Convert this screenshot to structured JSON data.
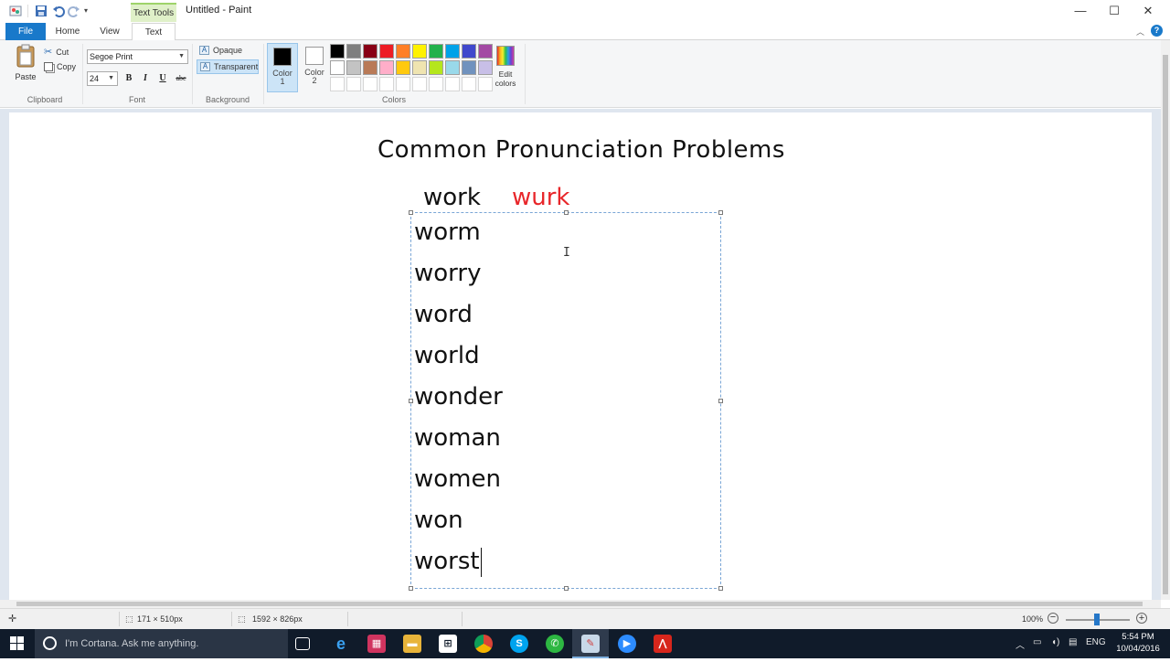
{
  "window": {
    "title": "Untitled - Paint",
    "context_tab": "Text Tools",
    "minimize": "—",
    "maximize": "☐",
    "close": "✕"
  },
  "ribbon_tabs": {
    "file": "File",
    "home": "Home",
    "view": "View",
    "text": "Text"
  },
  "clipboard": {
    "paste": "Paste",
    "cut": "Cut",
    "copy": "Copy",
    "group": "Clipboard"
  },
  "font": {
    "family": "Segoe Print",
    "size": "24",
    "bold": "B",
    "italic": "I",
    "underline": "U",
    "strike": "abc",
    "group": "Font"
  },
  "background": {
    "opaque": "Opaque",
    "transparent": "Transparent",
    "group": "Background"
  },
  "colors": {
    "color1_label": "Color",
    "color1_num": "1",
    "color2_label": "Color",
    "color2_num": "2",
    "color1_value": "#000000",
    "color2_value": "#ffffff",
    "edit_label_1": "Edit",
    "edit_label_2": "colors",
    "group": "Colors",
    "palette": [
      "#000000",
      "#7f7f7f",
      "#880015",
      "#ed1c24",
      "#ff7f27",
      "#fff200",
      "#22b14c",
      "#00a2e8",
      "#3f48cc",
      "#a349a4",
      "#ffffff",
      "#c3c3c3",
      "#b97a57",
      "#ffaec9",
      "#ffc90e",
      "#efe4b0",
      "#b5e61d",
      "#99d9ea",
      "#7092be",
      "#c8bfe7",
      "",
      "",
      "",
      "",
      "",
      "",
      "",
      "",
      "",
      ""
    ]
  },
  "canvas": {
    "title": "Common Pronunciation Problems",
    "word": "work",
    "pronunciation": "wurk",
    "pronunciation_color": "#e8262a",
    "words": [
      "worm",
      "worry",
      "word",
      "world",
      "wonder",
      "woman",
      "women",
      "won",
      "worst"
    ]
  },
  "status": {
    "selection_size": "171 × 510px",
    "image_size": "1592 × 826px",
    "zoom": "100%"
  },
  "taskbar": {
    "cortana_placeholder": "I'm Cortana. Ask me anything.",
    "language": "ENG",
    "time": "5:54 PM",
    "date": "10/04/2016"
  }
}
